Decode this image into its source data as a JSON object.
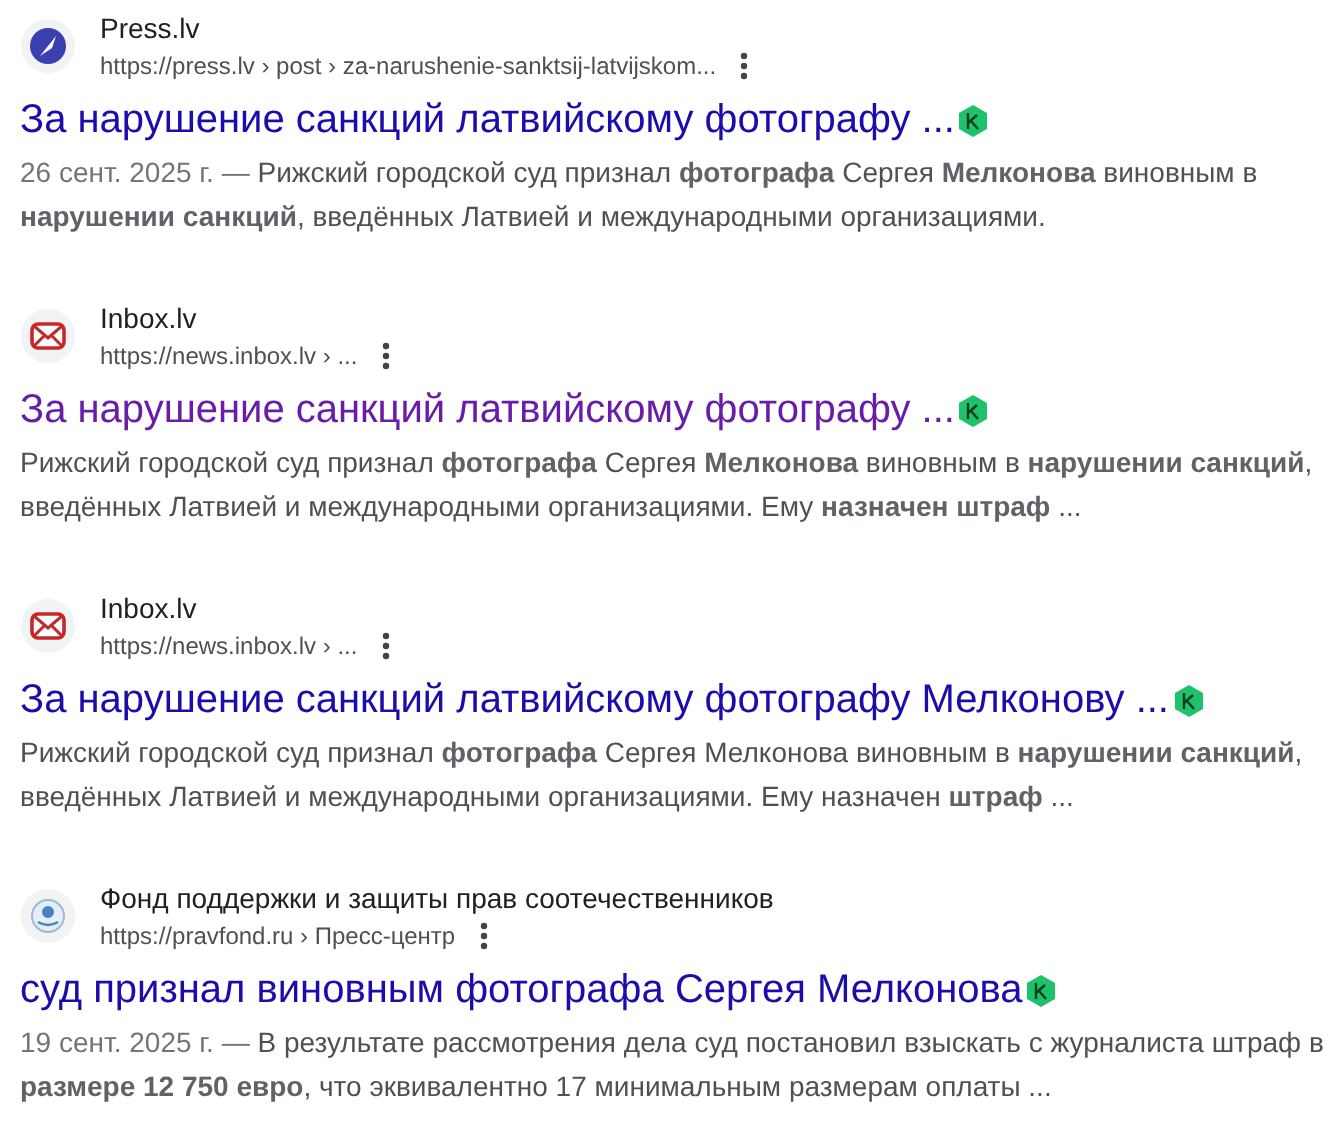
{
  "results": [
    {
      "site": "Press.lv",
      "favicon": {
        "kind": "quill"
      },
      "url": "https://press.lv › post › za-narushenie-sanktsij-latvijskom...",
      "title": "За нарушение санкций латвийскому фотографу ...",
      "visited": false,
      "date": "26 сент. 2025 г. —",
      "snippet": "Рижский городской суд признал **фотографа** Сергея **Мелконова** виновным в **нарушении санкций**, введённых Латвией и международными организациями."
    },
    {
      "site": "Inbox.lv",
      "favicon": {
        "kind": "envelope"
      },
      "url": "https://news.inbox.lv › ...",
      "title": "За нарушение санкций латвийскому фотографу ...",
      "visited": true,
      "snippet": "Рижский городской суд признал **фотографа** Сергея **Мелконова** виновным в **нарушении санкций**, введённых Латвией и международными организациями. Ему **назначен штраф** ..."
    },
    {
      "site": "Inbox.lv",
      "favicon": {
        "kind": "envelope"
      },
      "url": "https://news.inbox.lv › ...",
      "title": "За нарушение санкций латвийскому фотографу Мелконову ...",
      "visited": false,
      "snippet": "Рижский городской суд признал **фотографа** Сергея Мелконова виновным в **нарушении санкций**, введённых Латвией и международными организациями. Ему назначен **штраф** ..."
    },
    {
      "site": "Фонд поддержки и защиты прав соотечественников",
      "favicon": {
        "kind": "emblem"
      },
      "url": "https://pravfond.ru › Пресс-центр",
      "title": "суд признал виновным фотографа Сергея Мелконова",
      "visited": false,
      "date": "19 сент. 2025 г. —",
      "snippet": "В результате рассмотрения дела суд постановил взыскать с журналиста штраф в **размере 12 750 евро**, что эквивалентно 17 минимальным размерам оплаты ..."
    }
  ]
}
